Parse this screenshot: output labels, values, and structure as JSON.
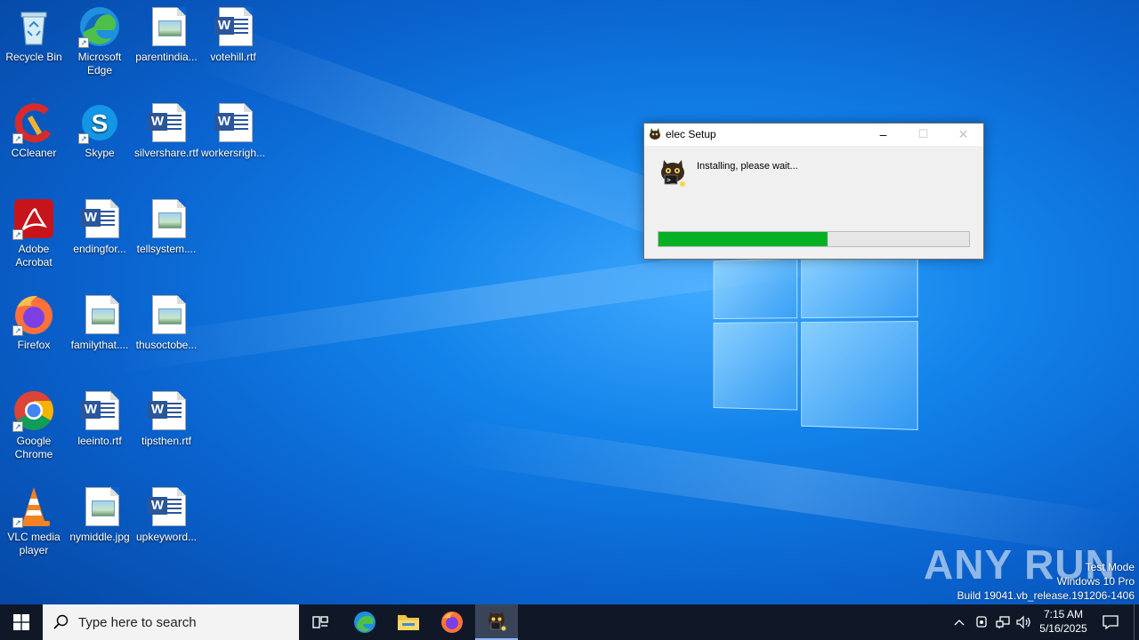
{
  "desktop": {
    "icons": [
      {
        "label": "Recycle Bin",
        "type": "recycle"
      },
      {
        "label": "Microsoft Edge",
        "type": "edge"
      },
      {
        "label": "parentindia...",
        "type": "image"
      },
      {
        "label": "votehill.rtf",
        "type": "word"
      },
      {
        "label": "CCleaner",
        "type": "ccleaner"
      },
      {
        "label": "Skype",
        "type": "skype"
      },
      {
        "label": "silvershare.rtf",
        "type": "word"
      },
      {
        "label": "workersrigh...",
        "type": "word"
      },
      {
        "label": "Adobe Acrobat",
        "type": "acrobat"
      },
      {
        "label": "endingfor...",
        "type": "word"
      },
      {
        "label": "tellsystem....",
        "type": "image"
      },
      {
        "label": "Firefox",
        "type": "firefox"
      },
      {
        "label": "familythat....",
        "type": "image"
      },
      {
        "label": "thusoctobe...",
        "type": "image"
      },
      {
        "label": "Google Chrome",
        "type": "chrome"
      },
      {
        "label": "leeinto.rtf",
        "type": "word"
      },
      {
        "label": "tipsthen.rtf",
        "type": "word"
      },
      {
        "label": "VLC media player",
        "type": "vlc"
      },
      {
        "label": "nymiddle.jpg",
        "type": "image"
      },
      {
        "label": "upkeyword...",
        "type": "word"
      }
    ]
  },
  "setup_window": {
    "title": "elec Setup",
    "minimize": "–",
    "maximize": "☐",
    "close": "✕",
    "status": "Installing, please wait...",
    "progress_fraction": 0.545,
    "progress_color": "#06b025"
  },
  "watermark": {
    "brand": "ANY RUN",
    "line1": "Test Mode",
    "line2": "Windows 10 Pro",
    "line3": "Build 19041.vb_release.191206-1406"
  },
  "taskbar": {
    "search_placeholder": "Type here to search",
    "apps": [
      "task-view",
      "edge",
      "file-explorer",
      "firefox",
      "elec-setup"
    ],
    "time": "7:15 AM",
    "date": "5/16/2025"
  }
}
